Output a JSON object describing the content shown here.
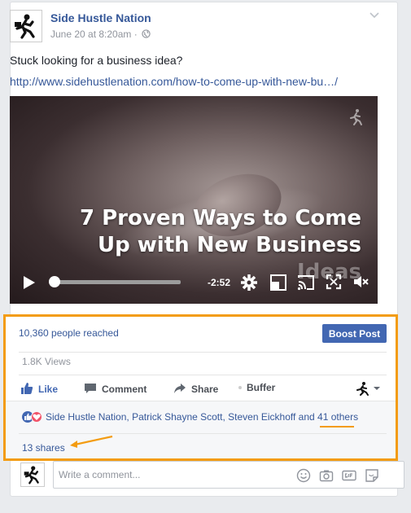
{
  "post": {
    "page_name": "Side Hustle Nation",
    "timestamp": "June 20 at 8:20am",
    "meta_separator": "·",
    "text": "Stuck looking for a business idea?",
    "link": "http://www.sidehustlenation.com/how-to-come-up-with-new-bu…/"
  },
  "video": {
    "title_line1": "7 Proven Ways to Come",
    "title_line2": "Up with New Business",
    "title_line3": "Ideas",
    "time_remaining": "-2:52",
    "progress": 0.04
  },
  "insights": {
    "reached": "10,360 people reached",
    "boost_label": "Boost Post",
    "views": "1.8K Views"
  },
  "actions": {
    "like": "Like",
    "comment": "Comment",
    "share": "Share",
    "buffer": "Buffer"
  },
  "reactions": {
    "name1": "Side Hustle Nation",
    "name2": "Patrick Shayne Scott",
    "name3": "Steven Eickhoff",
    "comma": ",",
    "and": "and",
    "others": "41 others"
  },
  "shares": "13 shares",
  "comment_box": {
    "placeholder": "Write a comment..."
  },
  "colors": {
    "link_blue": "#365899",
    "boost_blue": "#4267b2",
    "highlight_orange": "#f39c12"
  }
}
